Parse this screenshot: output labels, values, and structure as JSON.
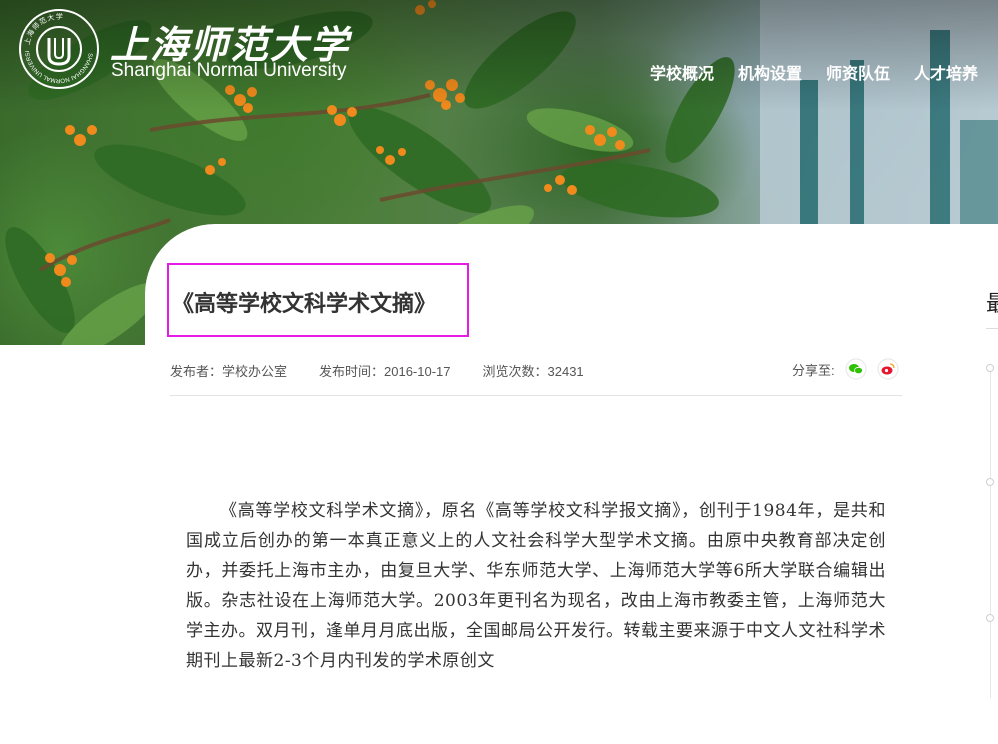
{
  "header": {
    "logo_cn": "上海师范大学",
    "logo_en": "Shanghai Normal University",
    "emblem_text": "SHANGHAI NORMAL UNIVERSITY",
    "emblem_text_cn": "上海师范大学",
    "nav": [
      {
        "label": "学校概况"
      },
      {
        "label": "机构设置"
      },
      {
        "label": "师资队伍"
      },
      {
        "label": "人才培养"
      }
    ]
  },
  "article": {
    "title": "《高等学校文科学术文摘》",
    "meta": {
      "publisher": "发布者：学校办公室",
      "publish_time": "发布时间：2016-10-17",
      "views": "浏览次数：32431"
    },
    "share_label": "分享至:",
    "share_icons": [
      "wechat-icon",
      "weibo-icon"
    ],
    "body": "《高等学校文科学术文摘》，原名《高等学校文科学报文摘》，创刊于1984年，是共和国成立后创办的第一本真正意义上的人文社会科学大型学术文摘。由原中央教育部决定创办，并委托上海市主办，由复旦大学、华东师范大学、上海师范大学等6所大学联合编辑出版。杂志社设在上海师范大学。2003年更刊名为现名，改由上海市教委主管，上海师范大学主办。双月刊，逢单月月底出版，全国邮局公开发行。转载主要来源于中文人文社科学术期刊上最新2-3个月内刊发的学术原创文"
  },
  "sidebar": {
    "heading_fragment": "最"
  },
  "colors": {
    "highlight_border": "#e41ce6",
    "wechat": "#2dc100",
    "weibo": "#e6162d"
  }
}
